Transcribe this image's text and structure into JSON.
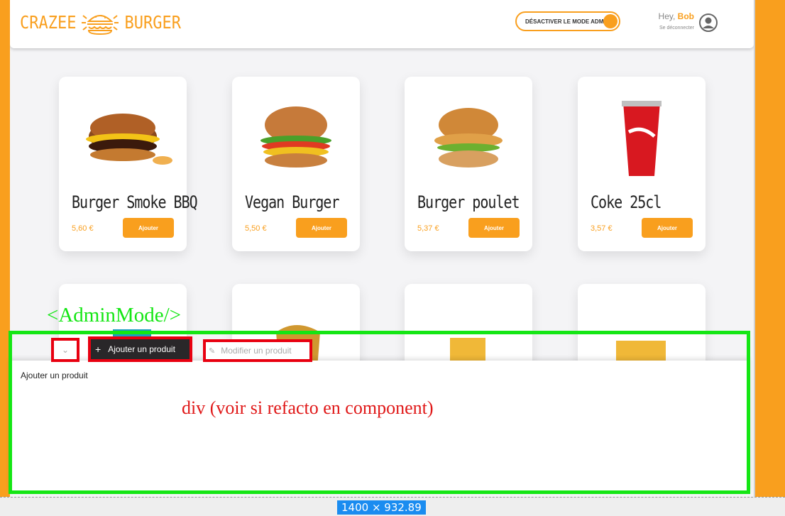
{
  "brand": {
    "name_left": "CRAZEE",
    "name_right": "BURGER",
    "logo_icon": "burger-logo-icon",
    "color": "#f99f1e"
  },
  "header": {
    "admin_toggle_label": "DÉSACTIVER LE MODE ADMIN",
    "greeting": "Hey,",
    "username": "Bob",
    "logout": "Se déconnecter",
    "avatar_icon": "user-circle-icon"
  },
  "products": [
    {
      "title": "Burger Smoke BBQ",
      "price": "5,60 €",
      "button": "Ajouter",
      "image": "burger-smoke-bbq-image"
    },
    {
      "title": "Vegan Burger",
      "price": "5,50 €",
      "button": "Ajouter",
      "image": "vegan-burger-image"
    },
    {
      "title": "Burger poulet",
      "price": "5,37 €",
      "button": "Ajouter",
      "image": "burger-poulet-image"
    },
    {
      "title": "Coke 25cl",
      "price": "3,57 €",
      "button": "Ajouter",
      "image": "coke-cup-image"
    }
  ],
  "admin_panel": {
    "annotation_label": "<AdminMode/>",
    "collapse_icon": "chevron-down-icon",
    "tab_add": "Ajouter un produit",
    "tab_edit": "Modifier un produit",
    "content_text": "Ajouter un produit",
    "note": "div (voir si refacto en component)"
  },
  "viewport_badge": "1400 × 932.89",
  "colors": {
    "accent": "#f99f1e",
    "annotation_green": "#14e614",
    "annotation_red": "#e80010"
  }
}
